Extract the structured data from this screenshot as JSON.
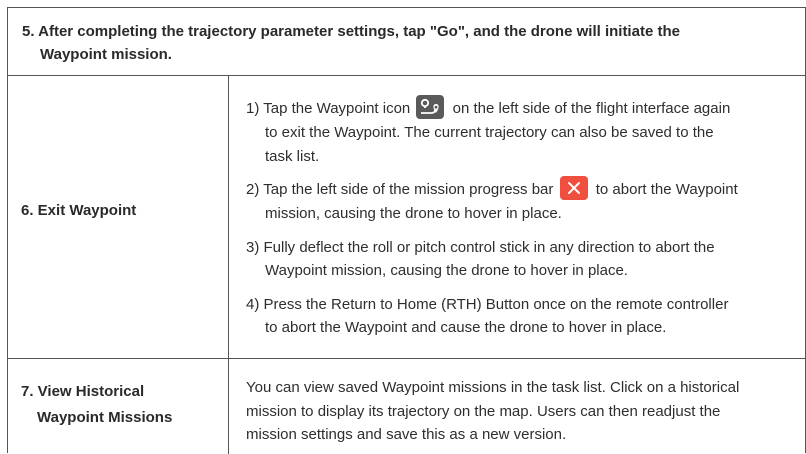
{
  "step5": {
    "line1": "5. After completing the trajectory parameter settings, tap \"Go\", and the drone will initiate the",
    "line2": "Waypoint mission."
  },
  "step6": {
    "label": "6. Exit Waypoint",
    "items": [
      {
        "pre": "1) Tap the Waypoint icon",
        "post": "on the left side of the flight interface again",
        "cont1": "to exit the Waypoint. The current trajectory can also be saved to the",
        "cont2": "task list."
      },
      {
        "pre": "2) Tap the left side of the mission progress bar",
        "post": "to abort the Waypoint",
        "cont1": "mission, causing the drone to hover in place."
      },
      {
        "pre": "3) Fully deflect the roll or pitch control stick in any direction to abort the",
        "cont1": "Waypoint mission, causing the drone to hover in place."
      },
      {
        "pre": "4) Press the Return to Home (RTH) Button once on the remote controller",
        "cont1": "to abort the Waypoint and cause the drone to hover in place."
      }
    ]
  },
  "step7": {
    "label1": "7. View Historical",
    "label2": "Waypoint Missions",
    "line1": "You can view saved Waypoint missions in the task list. Click on a historical",
    "line2": "mission to display its trajectory on the map. Users can then readjust the",
    "line3": "mission settings and save this as a new version."
  },
  "icons": {
    "waypoint": "waypoint-icon",
    "abort": "close-icon",
    "abort_color": "#f04e3e",
    "waypoint_bg": "#5a5a5a"
  }
}
